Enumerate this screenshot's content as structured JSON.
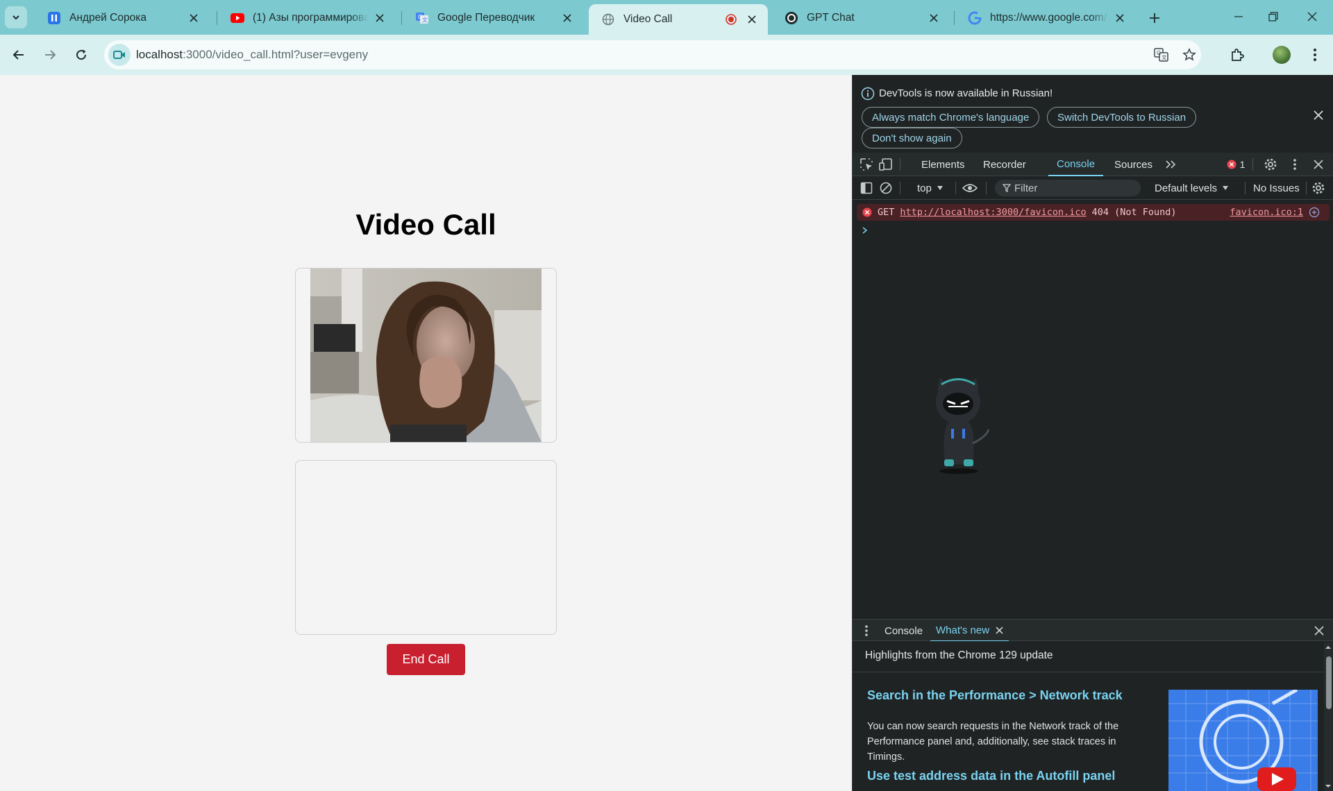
{
  "browser": {
    "tabs": [
      {
        "title": "Андрей Сорока",
        "icon": "pause-app-icon",
        "active": false
      },
      {
        "title": "(1) Азы программирования",
        "icon": "youtube-icon",
        "active": false
      },
      {
        "title": "Google Переводчик",
        "icon": "google-translate-icon",
        "active": false
      },
      {
        "title": "Video Call",
        "icon": "globe-icon",
        "active": true,
        "recording": true
      },
      {
        "title": "GPT Chat",
        "icon": "chatgpt-icon",
        "active": false
      },
      {
        "title": "https://www.google.com/s",
        "icon": "google-icon",
        "active": false
      }
    ],
    "url_host": "localhost",
    "url_rest": ":3000/video_call.html?user=evgeny"
  },
  "page": {
    "title": "Video Call",
    "end_call_label": "End Call"
  },
  "devtools": {
    "infobar": {
      "message": "DevTools is now available in Russian!",
      "match_language": "Always match Chrome's language",
      "switch_language": "Switch DevTools to Russian",
      "dont_show": "Don't show again"
    },
    "tabs": [
      "Elements",
      "Recorder",
      "Console",
      "Sources"
    ],
    "active_tab": "Console",
    "error_count": "1",
    "console_bar": {
      "context": "top",
      "filter_placeholder": "Filter",
      "levels": "Default levels",
      "issues": "No Issues"
    },
    "errors": [
      {
        "method": "GET",
        "url": "http://localhost:3000/favicon.ico",
        "status": "404 (Not Found)",
        "source": "favicon.ico:1"
      }
    ],
    "drawer": {
      "tabs": [
        "Console",
        "What's new"
      ],
      "active_tab": "What's new",
      "highlights": "Highlights from the Chrome 129 update",
      "item1_title": "Search in the Performance > Network track",
      "item1_body": "You can now search requests in the Network track of the Performance panel and, additionally, see stack traces in Timings.",
      "item2_title": "Use test address data in the Autofill panel"
    }
  },
  "colors": {
    "tabstrip": "#7cc9cf",
    "toolbar": "#d9f0f1",
    "end_call": "#c8202f",
    "devtools_bg": "#1f2324",
    "devtools_accent": "#7ad3f0"
  }
}
